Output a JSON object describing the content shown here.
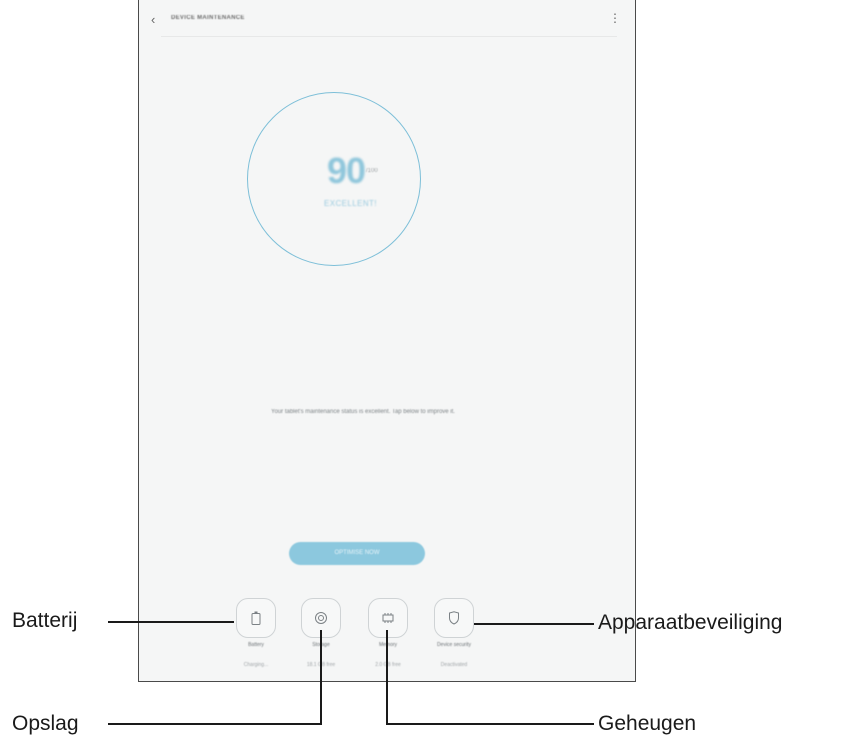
{
  "screen": {
    "appbar": {
      "back_icon": "chevron-left-icon",
      "title": "DEVICE MAINTENANCE",
      "more_icon": "more-vertical-icon"
    },
    "score": {
      "value": "90",
      "max": "/100",
      "status": "EXCELLENT!"
    },
    "message": "Your tablet's maintenance status is excellent. Tap below to improve it.",
    "optimize_button": "OPTIMISE NOW",
    "tiles": [
      {
        "icon": "battery-icon",
        "label": "Battery",
        "sub": "Charging..."
      },
      {
        "icon": "storage-icon",
        "label": "Storage",
        "sub": "18.1 GB free"
      },
      {
        "icon": "memory-chip-icon",
        "label": "Memory",
        "sub": "2.0 GB free"
      },
      {
        "icon": "shield-icon",
        "label": "Device security",
        "sub": "Deactivated"
      }
    ],
    "accent_color": "#7dbfd8"
  },
  "callouts": {
    "battery": "Batterij",
    "storage": "Opslag",
    "memory": "Geheugen",
    "security": "Apparaatbeveiliging"
  }
}
